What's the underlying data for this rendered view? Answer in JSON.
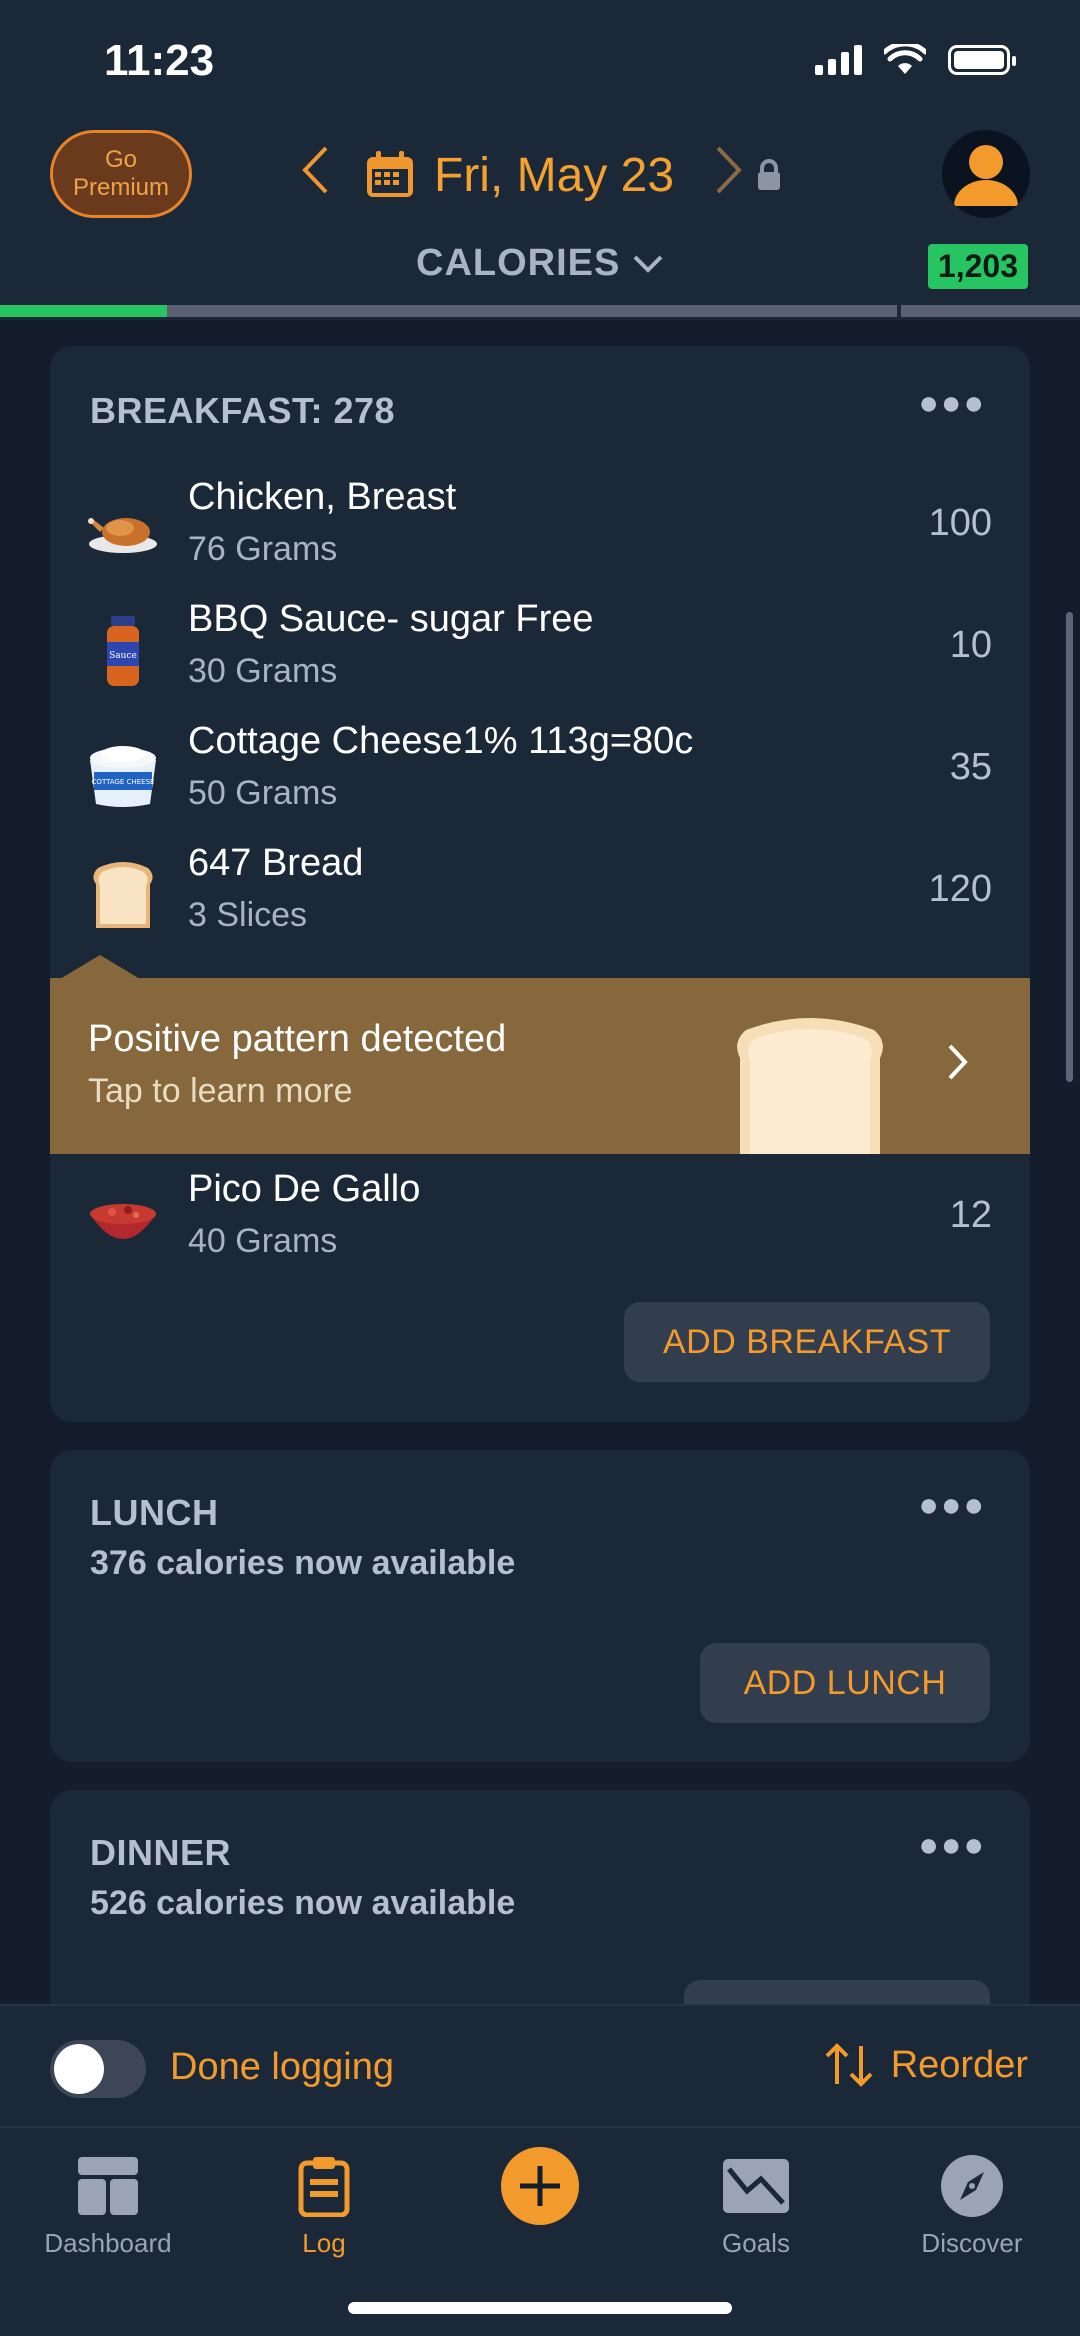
{
  "status_bar": {
    "time": "11:23"
  },
  "header": {
    "premium_label": "Go Premium",
    "date": "Fri, May 23",
    "summary_label": "CALORIES",
    "calories_remaining": "1,203",
    "progress_fraction": 0.155
  },
  "meals": {
    "breakfast": {
      "title": "BREAKFAST: 278",
      "items": [
        {
          "name": "Chicken, Breast",
          "quantity": "76 Grams",
          "calories": "100",
          "icon": "roast-chicken-icon"
        },
        {
          "name": "BBQ Sauce- sugar Free",
          "quantity": "30 Grams",
          "calories": "10",
          "icon": "sauce-jar-icon"
        },
        {
          "name": "Cottage Cheese1% 113g=80c",
          "quantity": "50 Grams",
          "calories": "35",
          "icon": "cottage-cheese-icon"
        },
        {
          "name": "647 Bread",
          "quantity": "3 Slices",
          "calories": "120",
          "icon": "bread-icon"
        },
        {
          "name": "Pico De Gallo",
          "quantity": "40 Grams",
          "calories": "12",
          "icon": "salsa-bowl-icon"
        }
      ],
      "add_label": "ADD BREAKFAST"
    },
    "lunch": {
      "title": "LUNCH",
      "subtitle": "376 calories now available",
      "add_label": "ADD LUNCH"
    },
    "dinner": {
      "title": "DINNER",
      "subtitle": "526 calories now available"
    }
  },
  "insight": {
    "title": "Positive pattern detected",
    "subtitle": "Tap to learn more"
  },
  "footer": {
    "done_label": "Done logging",
    "reorder_label": "Reorder"
  },
  "tabs": [
    {
      "label": "Dashboard"
    },
    {
      "label": "Log"
    },
    {
      "label": ""
    },
    {
      "label": "Goals"
    },
    {
      "label": "Discover"
    }
  ],
  "colors": {
    "accent": "#f39a2c",
    "success": "#27c562",
    "background": "#131d2c",
    "card": "#1b2838"
  }
}
